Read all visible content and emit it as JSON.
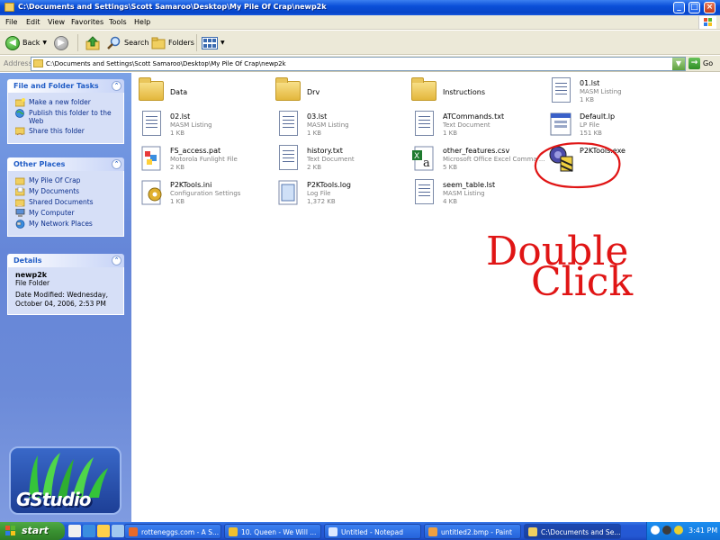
{
  "window": {
    "title": "C:\\Documents and Settings\\Scott Samaroo\\Desktop\\My Pile Of Crap\\newp2k",
    "minimize": "_",
    "maximize": "□",
    "close": "×"
  },
  "menu": [
    "File",
    "Edit",
    "View",
    "Favorites",
    "Tools",
    "Help"
  ],
  "toolbar": {
    "back_label": "Back",
    "search_label": "Search",
    "folders_label": "Folders",
    "back_icon": "back-arrow-icon",
    "forward_icon": "forward-arrow-icon"
  },
  "address": {
    "label": "Address",
    "path": "C:\\Documents and Settings\\Scott Samaroo\\Desktop\\My Pile Of Crap\\newp2k",
    "go_label": "Go"
  },
  "file_tasks": {
    "title": "File and Folder Tasks",
    "items": [
      "Make a new folder",
      "Publish this folder to the Web",
      "Share this folder"
    ]
  },
  "other_places": {
    "title": "Other Places",
    "items": [
      "My Pile Of Crap",
      "My Documents",
      "Shared Documents",
      "My Computer",
      "My Network Places"
    ]
  },
  "details": {
    "title": "Details",
    "name": "newp2k",
    "type": "File Folder",
    "modified": "Date Modified: Wednesday, October 04, 2006, 2:53 PM"
  },
  "logo": {
    "text": "GStudio"
  },
  "files": [
    {
      "name": "Data",
      "type": "",
      "size": "",
      "icon": "folder"
    },
    {
      "name": "Drv",
      "type": "",
      "size": "",
      "icon": "folder"
    },
    {
      "name": "Instructions",
      "type": "",
      "size": "",
      "icon": "folder"
    },
    {
      "name": "01.lst",
      "type": "MASM Listing",
      "size": "1 KB",
      "icon": "doc"
    },
    {
      "name": "02.lst",
      "type": "MASM Listing",
      "size": "1 KB",
      "icon": "doc"
    },
    {
      "name": "03.lst",
      "type": "MASM Listing",
      "size": "1 KB",
      "icon": "doc"
    },
    {
      "name": "ATCommands.txt",
      "type": "Text Document",
      "size": "1 KB",
      "icon": "doc"
    },
    {
      "name": "Default.lp",
      "type": "LP File",
      "size": "151 KB",
      "icon": "window"
    },
    {
      "name": "FS_access.pat",
      "type": "Motorola Funlight File",
      "size": "2 KB",
      "icon": "funlight"
    },
    {
      "name": "history.txt",
      "type": "Text Document",
      "size": "2 KB",
      "icon": "doc"
    },
    {
      "name": "other_features.csv",
      "type": "Microsoft Office Excel Comma ...",
      "size": "5 KB",
      "icon": "excel"
    },
    {
      "name": "P2KTools.exe",
      "type": "",
      "size": "",
      "icon": "exe"
    },
    {
      "name": "P2KTools.ini",
      "type": "Configuration Settings",
      "size": "1 KB",
      "icon": "ini"
    },
    {
      "name": "P2KTools.log",
      "type": "Log File",
      "size": "1,372 KB",
      "icon": "log"
    },
    {
      "name": "seem_table.lst",
      "type": "MASM Listing",
      "size": "4 KB",
      "icon": "doc"
    }
  ],
  "annotation": {
    "line1": "Double",
    "line2": "Click"
  },
  "taskbar": {
    "start_label": "start",
    "tasks": [
      "rotteneggs.com - A S...",
      "10. Queen - We Will ...",
      "Untitled - Notepad",
      "untitled2.bmp - Paint",
      "C:\\Documents and Se..."
    ],
    "clock": "3:41 PM"
  },
  "colors": {
    "accent": "#0a4fd8",
    "annotation": "#e01515",
    "taskbar": "#245ad6"
  }
}
